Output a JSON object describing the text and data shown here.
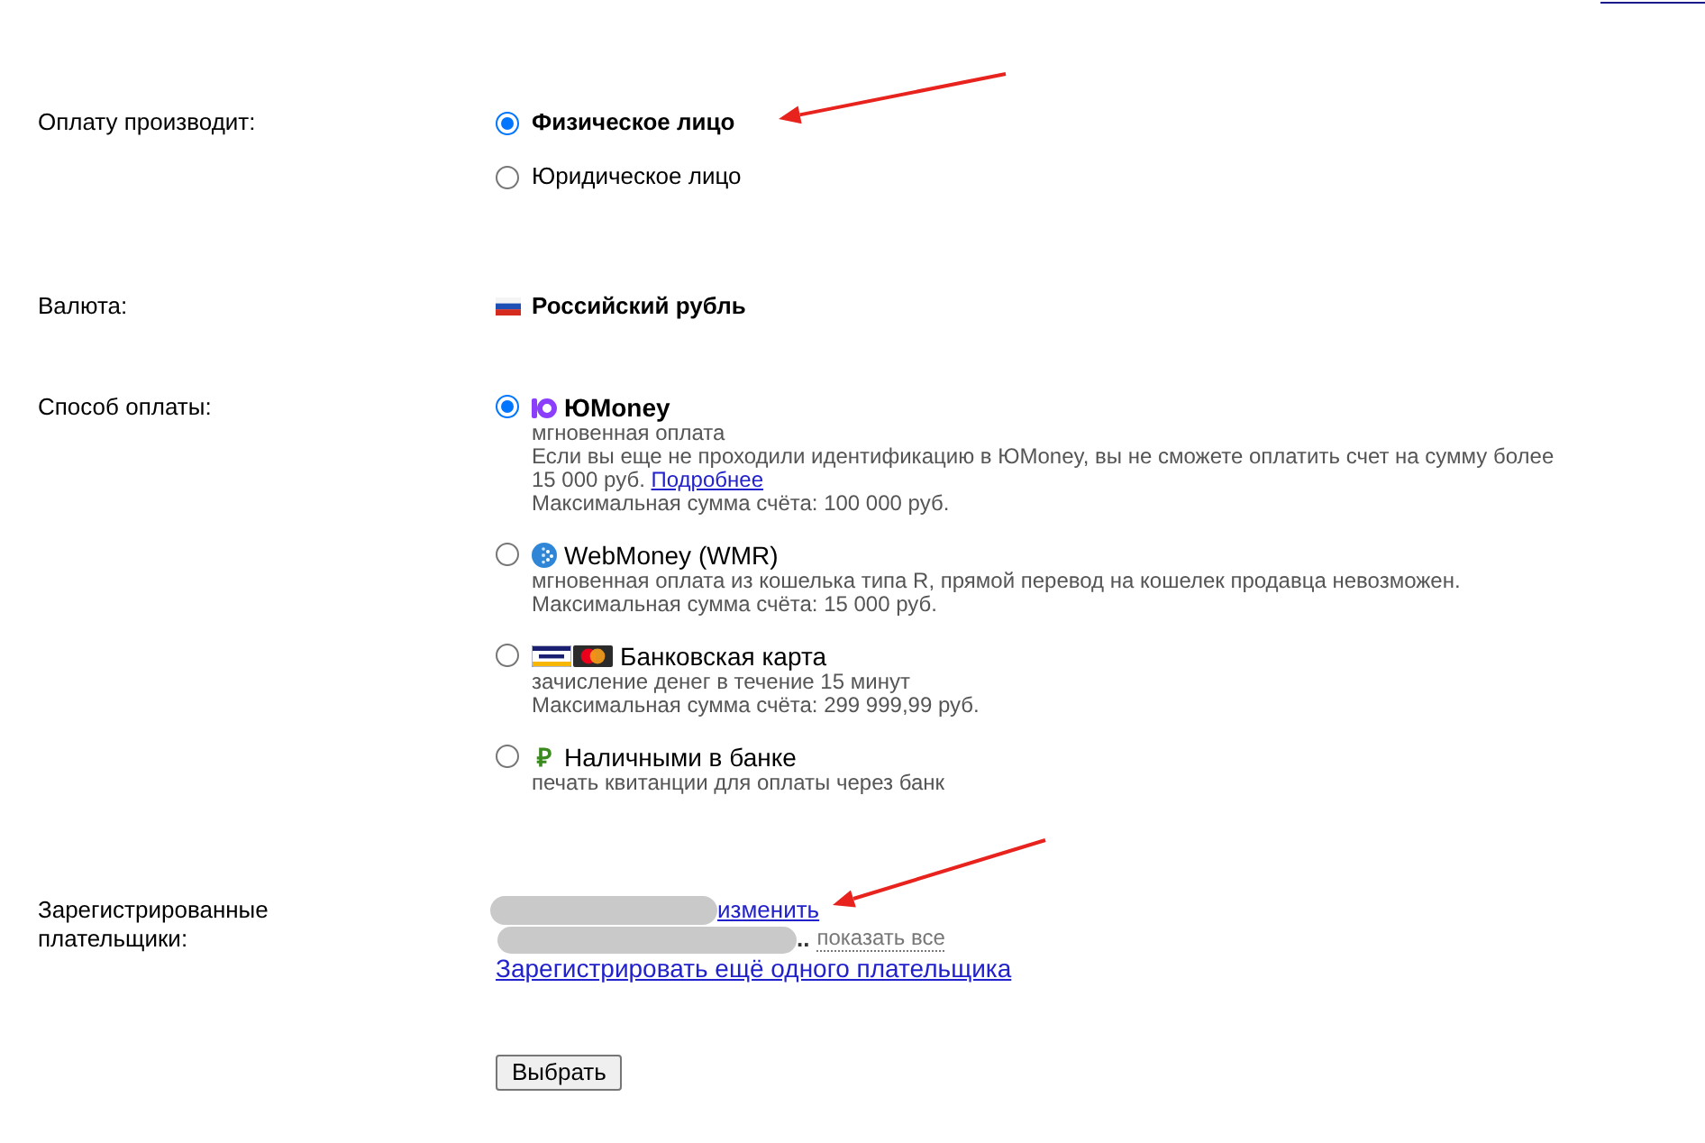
{
  "payer_type": {
    "label": "Оплату производит:",
    "options": [
      {
        "label": "Физическое лицо",
        "selected": true
      },
      {
        "label": "Юридическое лицо",
        "selected": false
      }
    ]
  },
  "currency": {
    "label": "Валюта:",
    "value": "Российский рубль"
  },
  "payment_method": {
    "label": "Способ оплаты:",
    "options": [
      {
        "kind": "yoomoney",
        "title": "ЮMoney",
        "selected": true,
        "details": [
          {
            "text": "мгновенная оплата"
          },
          {
            "text": "Если вы еще не проходили идентификацию в ЮMoney, вы не сможете оплатить счет на сумму более 15 000 руб.",
            "link": "Подробнее"
          },
          {
            "text": "Максимальная сумма счёта: 100 000 руб."
          }
        ]
      },
      {
        "kind": "webmoney",
        "title": "WebMoney (WMR)",
        "selected": false,
        "details": [
          {
            "text": "мгновенная оплата из кошелька типа R, прямой перевод на кошелек продавца невозможен."
          },
          {
            "text": "Максимальная сумма счёта: 15 000 руб."
          }
        ]
      },
      {
        "kind": "cards",
        "title": "Банковская карта",
        "selected": false,
        "details": [
          {
            "text": "зачисление денег в течение 15 минут"
          },
          {
            "text": "Максимальная сумма счёта: 299 999,99 руб."
          }
        ]
      },
      {
        "kind": "symbol",
        "symbol": "₽",
        "title": "Наличными в банке",
        "selected": false,
        "details": [
          {
            "text": "печать квитанции для оплаты через банк"
          }
        ]
      }
    ]
  },
  "registered_payers": {
    "label": "Зарегистрированные плательщики:",
    "entries": [
      {
        "kind": "link",
        "action": "изменить"
      },
      {
        "kind": "toggle",
        "suffix": "..",
        "action": "показать все"
      }
    ],
    "add_link": "Зарегистрировать ещё одного плательщика"
  },
  "submit_button": "Выбрать"
}
